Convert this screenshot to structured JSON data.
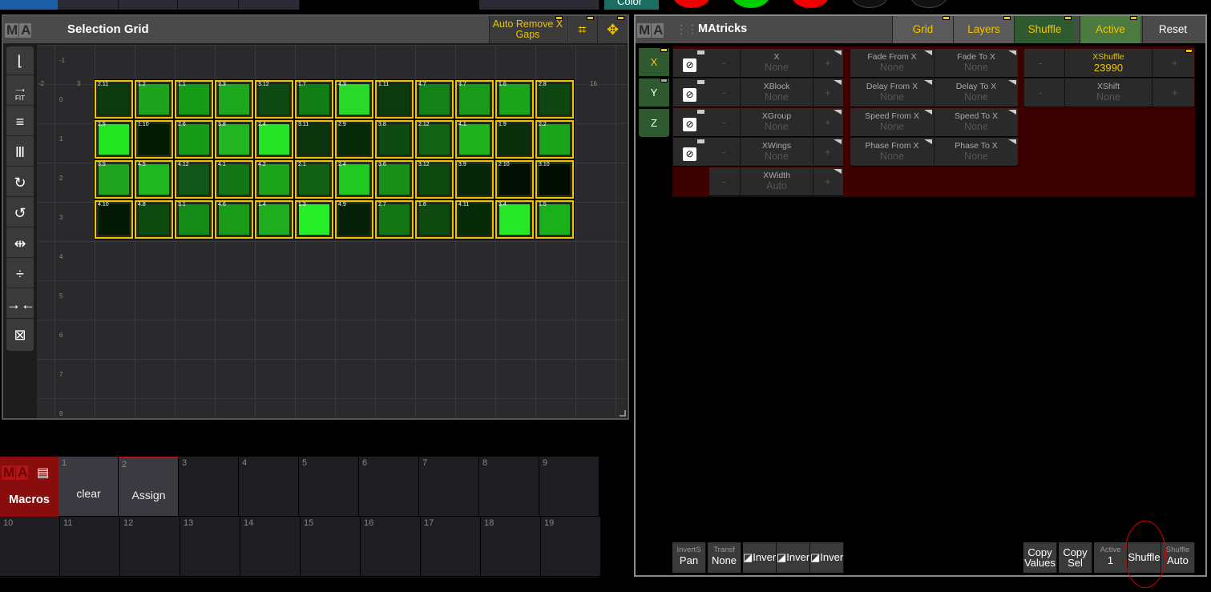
{
  "topbar": {
    "color_label": "Color"
  },
  "selection_grid": {
    "logo": [
      "M",
      "A"
    ],
    "title": "Selection Grid",
    "auto_remove": "Auto Remove X Gaps",
    "tools": [
      "fit-icon"
    ],
    "fit_label": "FIT",
    "y_labels": [
      "-1",
      "0",
      "1",
      "2",
      "3",
      "4",
      "5",
      "6",
      "7",
      "8"
    ],
    "x_labels": [
      "-2",
      "3",
      "16"
    ],
    "rows": [
      [
        {
          "l": "2.11",
          "c": "#0d3a10"
        },
        {
          "l": "1.2",
          "c": "#1ea31e"
        },
        {
          "l": "1.1",
          "c": "#179a17"
        },
        {
          "l": "3.3",
          "c": "#1fa81f"
        },
        {
          "l": "3.12",
          "c": "#0f4a12"
        },
        {
          "l": "1.7",
          "c": "#137d15"
        },
        {
          "l": "4.3",
          "c": "#2ad82a"
        },
        {
          "l": "1.11",
          "c": "#0c3a0e"
        },
        {
          "l": "4.7",
          "c": "#15801a"
        },
        {
          "l": "3.7",
          "c": "#1a9a1a"
        },
        {
          "l": "1.6",
          "c": "#1ba51c"
        },
        {
          "l": "2.8",
          "c": "#0e4612"
        }
      ],
      [
        {
          "l": "2.5",
          "c": "#22e622"
        },
        {
          "l": "1.10",
          "c": "#031a05"
        },
        {
          "l": "2.6",
          "c": "#169a17"
        },
        {
          "l": "3.8",
          "c": "#21b521"
        },
        {
          "l": "2.4",
          "c": "#25e425"
        },
        {
          "l": "3.11",
          "c": "#0b360d"
        },
        {
          "l": "2.9",
          "c": "#062a08"
        },
        {
          "l": "3.8",
          "c": "#0f4a12"
        },
        {
          "l": "2.12",
          "c": "#126414"
        },
        {
          "l": "4.1",
          "c": "#1fb21f"
        },
        {
          "l": "1.9",
          "c": "#082e0a"
        },
        {
          "l": "2.2",
          "c": "#1aa51a"
        }
      ],
      [
        {
          "l": "3.5",
          "c": "#1fa51f"
        },
        {
          "l": "4.5",
          "c": "#20b820"
        },
        {
          "l": "4.12",
          "c": "#10551a"
        },
        {
          "l": "4.1",
          "c": "#137515"
        },
        {
          "l": "4.2",
          "c": "#1ba31c"
        },
        {
          "l": "2.1",
          "c": "#126012"
        },
        {
          "l": "2.4",
          "c": "#21c821"
        },
        {
          "l": "3.6",
          "c": "#188f18"
        },
        {
          "l": "3.12",
          "c": "#0e4a10"
        },
        {
          "l": "3.9",
          "c": "#052608"
        },
        {
          "l": "2.10",
          "c": "#010f02"
        },
        {
          "l": "3.10",
          "c": "#010c02"
        }
      ],
      [
        {
          "l": "4.10",
          "c": "#031805"
        },
        {
          "l": "4.8",
          "c": "#0d4a10"
        },
        {
          "l": "3.1",
          "c": "#168a16"
        },
        {
          "l": "4.6",
          "c": "#199a19"
        },
        {
          "l": "1.4",
          "c": "#1fad1f"
        },
        {
          "l": "1.3",
          "c": "#27ef27"
        },
        {
          "l": "4.9",
          "c": "#042006"
        },
        {
          "l": "2.7",
          "c": "#137515"
        },
        {
          "l": "1.8",
          "c": "#0e4a10"
        },
        {
          "l": "4.11",
          "c": "#052a08"
        },
        {
          "l": "3.4",
          "c": "#26e826"
        },
        {
          "l": "1.5",
          "c": "#1ab01b"
        }
      ]
    ]
  },
  "macros": {
    "title": "Macros",
    "logo": [
      "M",
      "A"
    ],
    "cells": [
      {
        "n": "1",
        "label": "clear"
      },
      {
        "n": "2",
        "label": "Assign"
      },
      {
        "n": "3",
        "label": ""
      },
      {
        "n": "4",
        "label": ""
      },
      {
        "n": "5",
        "label": ""
      },
      {
        "n": "6",
        "label": ""
      },
      {
        "n": "7",
        "label": ""
      },
      {
        "n": "8",
        "label": ""
      },
      {
        "n": "9",
        "label": ""
      },
      {
        "n": "10",
        "label": ""
      },
      {
        "n": "11",
        "label": ""
      },
      {
        "n": "12",
        "label": ""
      },
      {
        "n": "13",
        "label": ""
      },
      {
        "n": "14",
        "label": ""
      },
      {
        "n": "15",
        "label": ""
      },
      {
        "n": "16",
        "label": ""
      },
      {
        "n": "17",
        "label": ""
      },
      {
        "n": "18",
        "label": ""
      },
      {
        "n": "19",
        "label": ""
      }
    ]
  },
  "matricks": {
    "logo": [
      "M",
      "A"
    ],
    "title": "MAtricks",
    "tabs": {
      "grid": "Grid",
      "layers": "Layers",
      "shuffle": "Shuffle",
      "active": "Active",
      "reset": "Reset"
    },
    "axes": [
      "X",
      "Y",
      "Z"
    ],
    "params": [
      {
        "name": "X",
        "value": "None"
      },
      {
        "name": "XBlock",
        "value": "None"
      },
      {
        "name": "XGroup",
        "value": "None"
      },
      {
        "name": "XWings",
        "value": "None"
      },
      {
        "name": "XWidth",
        "value": "Auto"
      }
    ],
    "fades": [
      {
        "a": "Fade From X",
        "av": "None",
        "b": "Fade To X",
        "bv": "None"
      },
      {
        "a": "Delay From X",
        "av": "None",
        "b": "Delay To X",
        "bv": "None"
      },
      {
        "a": "Speed From X",
        "av": "None",
        "b": "Speed To X",
        "bv": "None"
      },
      {
        "a": "Phase From X",
        "av": "None",
        "b": "Phase To X",
        "bv": "None"
      }
    ],
    "xshuffle": {
      "label": "XShuffle",
      "value": "23990"
    },
    "xshift": {
      "label": "XShift",
      "value": "None"
    },
    "minus": "-",
    "plus": "+",
    "bottom": {
      "invert_pan_top": "InvertS",
      "invert_pan": "Pan",
      "transf_top": "Transf",
      "transf": "None",
      "inver": "Inver",
      "copy_values": "Copy Values",
      "copy_sel": "Copy Sel",
      "active_top": "Active",
      "active_val": "1",
      "shuffle": "Shuffle",
      "shuffle_top": "Shuffle",
      "shuffle_val": "Auto"
    }
  },
  "colors": {
    "accent": "#f0c400",
    "green": "#2f5a2f",
    "red": "#8a0d0d"
  }
}
